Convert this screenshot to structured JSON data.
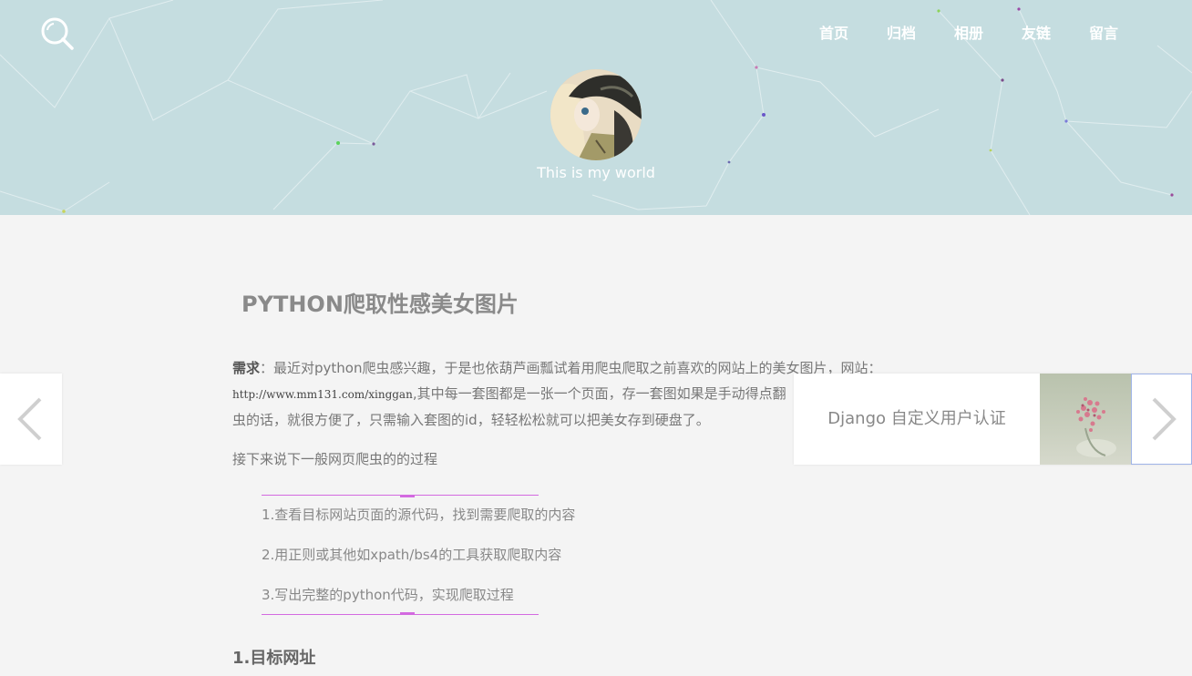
{
  "header": {
    "motto": "This is my world",
    "nav": [
      "首页",
      "归档",
      "相册",
      "友链",
      "留言"
    ],
    "bg_color": "#c5dde0"
  },
  "article": {
    "title": "PYTHON爬取性感美女图片",
    "p1_label": "需求",
    "p1_text_a": "：最近对python爬虫感兴趣，于是也依葫芦画瓢试着用爬虫爬取之前喜欢的网站上的美女图片，网站：",
    "p1_url": "http://www.mm131.com/xinggan",
    "p1_text_b": ",其中每一套图都是一张一个页面，存一套图如果是手动得点翻",
    "p1_text_c": "虫的话，就很方便了，只需输入套图的id，轻轻松松就可以把美女存到硬盘了。",
    "p2": "接下来说下一般网页爬虫的的过程",
    "steps": [
      "1.查看目标网站页面的源代码，找到需要爬取的内容",
      "2.用正则或其他如xpath/bs4的工具获取爬取内容",
      "3.写出完整的python代码，实现爬取过程"
    ],
    "h2": "1.目标网址",
    "accent": "#d36ae0"
  },
  "pager": {
    "next_title": "Django 自定义用户认证"
  }
}
